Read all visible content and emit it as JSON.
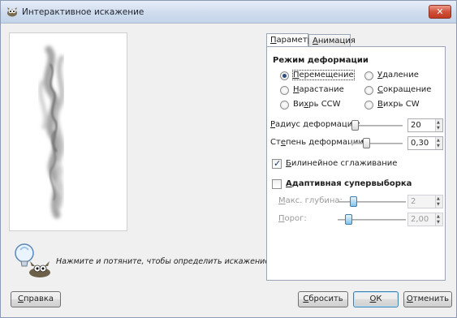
{
  "window": {
    "title": "Интерактивное искажение",
    "close_label": "✕",
    "icon": "gimp-icon"
  },
  "hint": {
    "icon": "lightbulb-wilber-icon",
    "text": "Нажмите и потяните, чтобы определить искажение."
  },
  "tabs": [
    {
      "label_underlined": "П",
      "label_rest": "араметры",
      "selected": true
    },
    {
      "label_underlined": "А",
      "label_rest": "нимация",
      "selected": false
    }
  ],
  "mode": {
    "title": "Режим деформации",
    "options": [
      {
        "pre": "",
        "u": "П",
        "post": "еремещение",
        "selected": true
      },
      {
        "pre": "",
        "u": "У",
        "post": "даление",
        "selected": false
      },
      {
        "pre": "",
        "u": "Н",
        "post": "арастание",
        "selected": false
      },
      {
        "pre": "",
        "u": "С",
        "post": "окращение",
        "selected": false
      },
      {
        "pre": "Ви",
        "u": "х",
        "post": "рь CCW",
        "selected": false
      },
      {
        "pre": "",
        "u": "В",
        "post": "ихрь CW",
        "selected": false
      }
    ]
  },
  "radius": {
    "u": "Р",
    "rest": "адиус деформации:",
    "value": "20",
    "fraction": 0.06
  },
  "amount": {
    "pre": "Ст",
    "u": "е",
    "rest": "пень деформации:",
    "value": "0,30",
    "fraction": 0.3
  },
  "bilinear": {
    "u": "Б",
    "rest": "илинейное сглаживание",
    "checked": true
  },
  "adaptive": {
    "u": "А",
    "rest": "даптивная супервыборка",
    "checked": false
  },
  "max_depth": {
    "u": "М",
    "rest": "акс. глубина:",
    "value": "2",
    "fraction": 0.2
  },
  "threshold": {
    "u": "П",
    "rest": "орог:",
    "value": "2,00",
    "fraction": 0.12
  },
  "buttons": {
    "help": {
      "u": "С",
      "rest": "правка"
    },
    "reset": {
      "u": "С",
      "rest": "бросить"
    },
    "ok": {
      "u": "О",
      "rest": "К"
    },
    "cancel": {
      "u": "О",
      "rest": "тменить"
    }
  },
  "colors": {
    "accent": "#3c7fb1",
    "close": "#c23b24"
  }
}
